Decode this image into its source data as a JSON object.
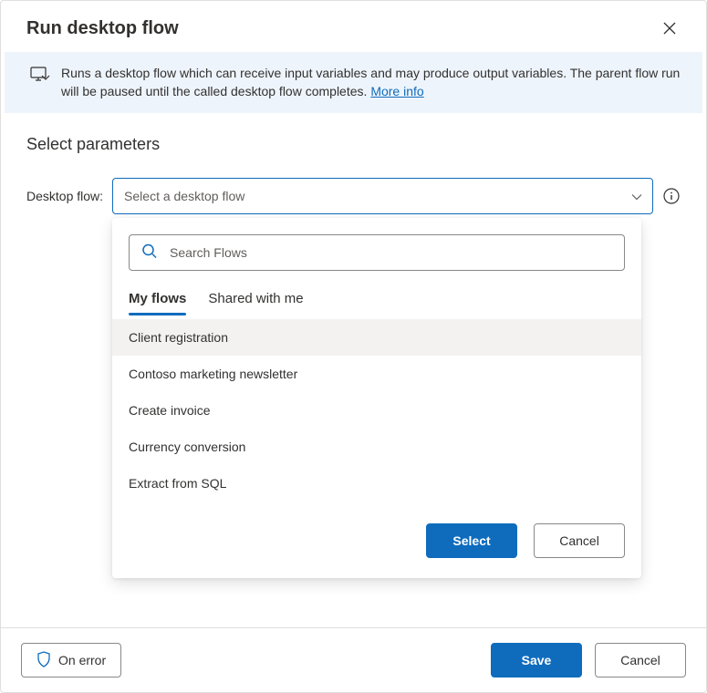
{
  "header": {
    "title": "Run desktop flow"
  },
  "banner": {
    "text_prefix": "Runs a desktop flow which can receive input variables and may produce output variables. The parent flow run will be paused until the called desktop flow completes. ",
    "more_info": "More info"
  },
  "section": {
    "title": "Select parameters"
  },
  "field": {
    "label": "Desktop flow:",
    "placeholder": "Select a desktop flow"
  },
  "dropdown": {
    "search_placeholder": "Search Flows",
    "tabs": {
      "my_flows": "My flows",
      "shared": "Shared with me"
    },
    "items": [
      "Client registration",
      "Contoso marketing newsletter",
      "Create invoice",
      "Currency conversion",
      "Extract from SQL"
    ],
    "select_label": "Select",
    "cancel_label": "Cancel"
  },
  "footer": {
    "on_error": "On error",
    "save": "Save",
    "cancel": "Cancel"
  }
}
